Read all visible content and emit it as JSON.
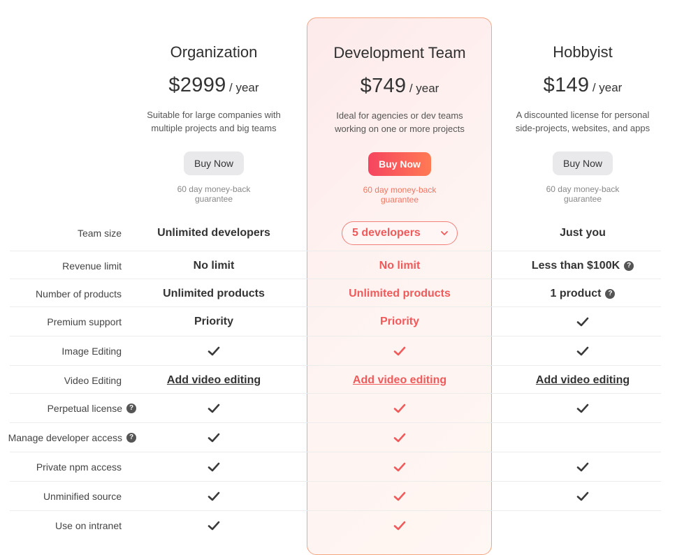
{
  "plans": [
    {
      "title": "Organization",
      "price": "$2999",
      "period": "/ year",
      "desc_line1": "Suitable for large companies with",
      "desc_line2": "multiple projects and big teams",
      "button": "Buy Now",
      "guarantee_line1": "60 day money-back",
      "guarantee_line2": "guarantee"
    },
    {
      "title": "Development Team",
      "price": "$749",
      "period": "/ year",
      "desc_line1": "Ideal for agencies or dev teams",
      "desc_line2": "working on one or more projects",
      "button": "Buy Now",
      "guarantee_line1": "60 day money-back",
      "guarantee_line2": "guarantee"
    },
    {
      "title": "Hobbyist",
      "price": "$149",
      "period": "/ year",
      "desc_line1": "A discounted license for personal",
      "desc_line2": "side-projects, websites, and apps",
      "button": "Buy Now",
      "guarantee_line1": "60 day money-back",
      "guarantee_line2": "guarantee"
    }
  ],
  "features": {
    "team_size": {
      "label": "Team size",
      "org": "Unlimited developers",
      "team_select": "5 developers",
      "hobby": "Just you"
    },
    "revenue_limit": {
      "label": "Revenue limit",
      "org": "No limit",
      "team": "No limit",
      "hobby": "Less than $100K"
    },
    "products": {
      "label": "Number of products",
      "org": "Unlimited products",
      "team": "Unlimited products",
      "hobby": "1 product"
    },
    "support": {
      "label": "Premium support",
      "org": "Priority",
      "team": "Priority"
    },
    "image_editing": {
      "label": "Image Editing"
    },
    "video_editing": {
      "label": "Video Editing",
      "org": "Add video editing",
      "team": "Add video editing",
      "hobby": "Add video editing"
    },
    "perpetual": {
      "label": "Perpetual license"
    },
    "dev_access": {
      "label": "Manage developer access"
    },
    "npm": {
      "label": "Private npm access"
    },
    "unminified": {
      "label": "Unminified source"
    },
    "intranet": {
      "label": "Use on intranet"
    }
  },
  "icons": {
    "check": "check-icon",
    "help": "help-circle-icon",
    "dropdown": "chevron-down-icon"
  },
  "colors": {
    "accent": "#f05a5a",
    "accent_gradient_start": "#f5455f",
    "accent_gradient_end": "#ff7a54",
    "check": "#3a3a3a"
  }
}
